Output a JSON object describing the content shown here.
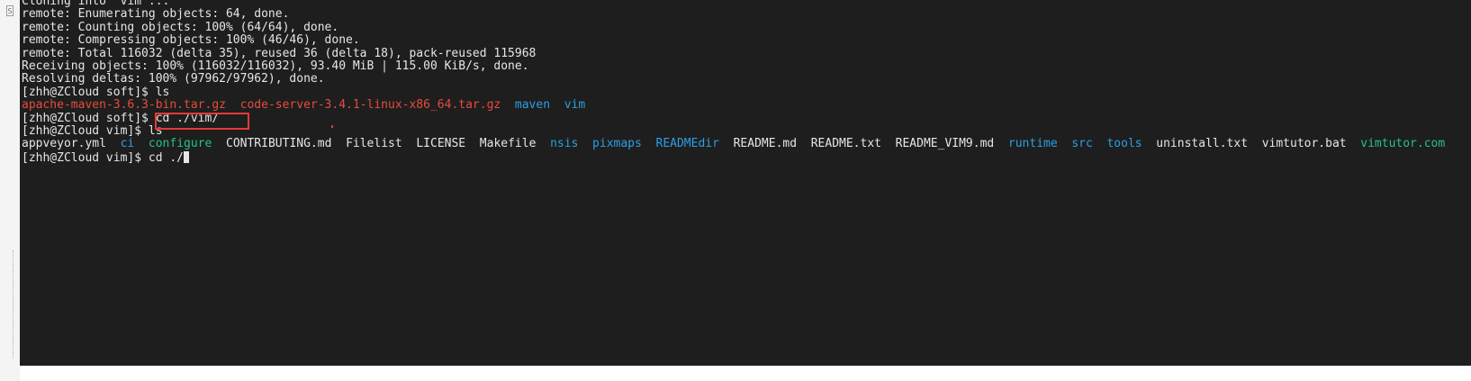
{
  "terminal": {
    "lines": [
      [
        {
          "t": "Cloning into 'vim'...",
          "c": "default"
        }
      ],
      [
        {
          "t": "remote: Enumerating objects: 64, done.",
          "c": "default"
        }
      ],
      [
        {
          "t": "remote: Counting objects: 100% (64/64), done.",
          "c": "default"
        }
      ],
      [
        {
          "t": "remote: Compressing objects: 100% (46/46), done.",
          "c": "default"
        }
      ],
      [
        {
          "t": "remote: Total 116032 (delta 35), reused 36 (delta 18), pack-reused 115968",
          "c": "default"
        }
      ],
      [
        {
          "t": "Receiving objects: 100% (116032/116032), 93.40 MiB | 115.00 KiB/s, done.",
          "c": "default"
        }
      ],
      [
        {
          "t": "Resolving deltas: 100% (97962/97962), done.",
          "c": "default"
        }
      ],
      [
        {
          "t": "[zhh@ZCloud soft]$ ls",
          "c": "default"
        }
      ],
      [
        {
          "t": "apache-maven-3.6.3-bin.tar.gz",
          "c": "red"
        },
        {
          "t": "  ",
          "c": "default"
        },
        {
          "t": "code-server-3.4.1-linux-x86_64.tar.gz",
          "c": "red"
        },
        {
          "t": "  ",
          "c": "default"
        },
        {
          "t": "maven",
          "c": "blue"
        },
        {
          "t": "  ",
          "c": "default"
        },
        {
          "t": "vim",
          "c": "blue"
        }
      ],
      [
        {
          "t": "[zhh@ZCloud soft]$ cd ./vim/",
          "c": "default"
        }
      ],
      [
        {
          "t": "[zhh@ZCloud vim]$ ls",
          "c": "default"
        }
      ],
      [
        {
          "t": "appveyor.yml",
          "c": "default"
        },
        {
          "t": "  ",
          "c": "default"
        },
        {
          "t": "ci",
          "c": "blue"
        },
        {
          "t": "  ",
          "c": "default"
        },
        {
          "t": "configure",
          "c": "green"
        },
        {
          "t": "  ",
          "c": "default"
        },
        {
          "t": "CONTRIBUTING.md",
          "c": "default"
        },
        {
          "t": "  ",
          "c": "default"
        },
        {
          "t": "Filelist",
          "c": "default"
        },
        {
          "t": "  ",
          "c": "default"
        },
        {
          "t": "LICENSE",
          "c": "default"
        },
        {
          "t": "  ",
          "c": "default"
        },
        {
          "t": "Makefile",
          "c": "default"
        },
        {
          "t": "  ",
          "c": "default"
        },
        {
          "t": "nsis",
          "c": "blue"
        },
        {
          "t": "  ",
          "c": "default"
        },
        {
          "t": "pixmaps",
          "c": "blue"
        },
        {
          "t": "  ",
          "c": "default"
        },
        {
          "t": "READMEdir",
          "c": "blue"
        },
        {
          "t": "  ",
          "c": "default"
        },
        {
          "t": "README.md",
          "c": "default"
        },
        {
          "t": "  ",
          "c": "default"
        },
        {
          "t": "README.txt",
          "c": "default"
        },
        {
          "t": "  ",
          "c": "default"
        },
        {
          "t": "README_VIM9.md",
          "c": "default"
        },
        {
          "t": "  ",
          "c": "default"
        },
        {
          "t": "runtime",
          "c": "blue"
        },
        {
          "t": "  ",
          "c": "default"
        },
        {
          "t": "src",
          "c": "blue"
        },
        {
          "t": "  ",
          "c": "default"
        },
        {
          "t": "tools",
          "c": "blue"
        },
        {
          "t": "  ",
          "c": "default"
        },
        {
          "t": "uninstall.txt",
          "c": "default"
        },
        {
          "t": "  ",
          "c": "default"
        },
        {
          "t": "vimtutor.bat",
          "c": "default"
        },
        {
          "t": "  ",
          "c": "default"
        },
        {
          "t": "vimtutor.com",
          "c": "green"
        }
      ],
      [
        {
          "t": "[zhh@ZCloud vim]$ cd ./",
          "c": "default"
        }
      ]
    ],
    "colors": {
      "background": "#1e1e1e",
      "default": "#e6e6e6",
      "red": "#e74c3c",
      "blue": "#2c9fe3",
      "green": "#26c281",
      "annotation": "#e53935"
    }
  },
  "gutter": {
    "marker_icon": "window-marker-icon"
  }
}
